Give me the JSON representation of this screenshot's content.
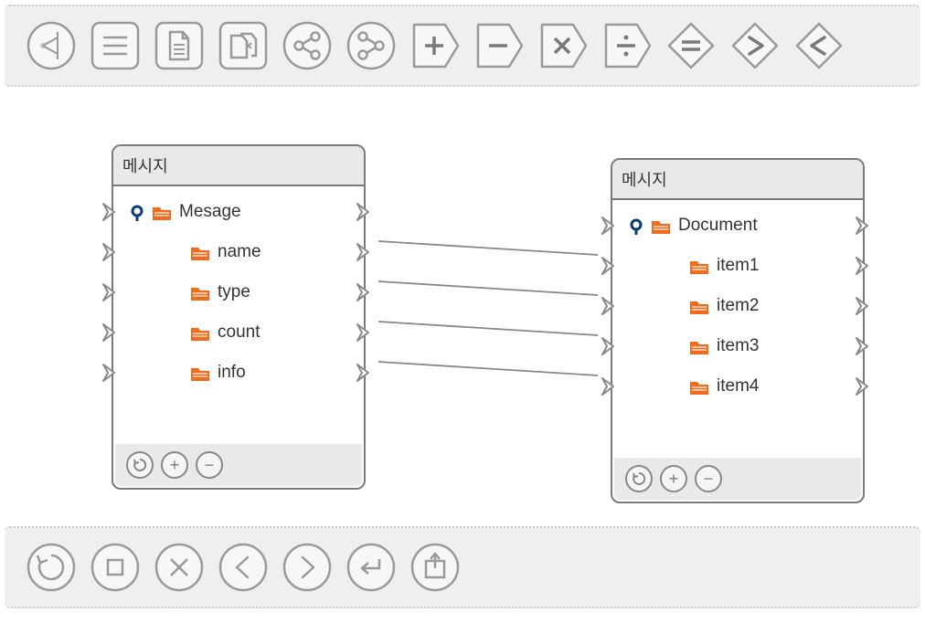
{
  "toolbar_top": [
    {
      "name": "node-icon"
    },
    {
      "name": "document-icon"
    },
    {
      "name": "page-icon"
    },
    {
      "name": "files-icon"
    },
    {
      "name": "share-icon"
    },
    {
      "name": "share2-icon"
    },
    {
      "name": "plus-shape-icon"
    },
    {
      "name": "minus-shape-icon"
    },
    {
      "name": "multiply-shape-icon"
    },
    {
      "name": "divide-shape-icon"
    },
    {
      "name": "equals-shape-icon"
    },
    {
      "name": "gt-shape-icon"
    },
    {
      "name": "lt-shape-icon"
    }
  ],
  "toolbar_bottom": [
    {
      "name": "refresh-icon"
    },
    {
      "name": "stop-icon"
    },
    {
      "name": "close-icon"
    },
    {
      "name": "prev-icon"
    },
    {
      "name": "next-icon"
    },
    {
      "name": "enter-icon"
    },
    {
      "name": "upload-icon"
    }
  ],
  "panels": {
    "a": {
      "title": "메시지",
      "root": "Mesage",
      "items": [
        "name",
        "type",
        "count",
        "info"
      ]
    },
    "b": {
      "title": "메시지",
      "root": "Document",
      "items": [
        "item1",
        "item2",
        "item3",
        "item4"
      ]
    }
  },
  "connections": [
    {
      "from_item": 0,
      "to_item": 0
    },
    {
      "from_item": 1,
      "to_item": 1
    },
    {
      "from_item": 2,
      "to_item": 2
    },
    {
      "from_item": 3,
      "to_item": 3
    }
  ]
}
